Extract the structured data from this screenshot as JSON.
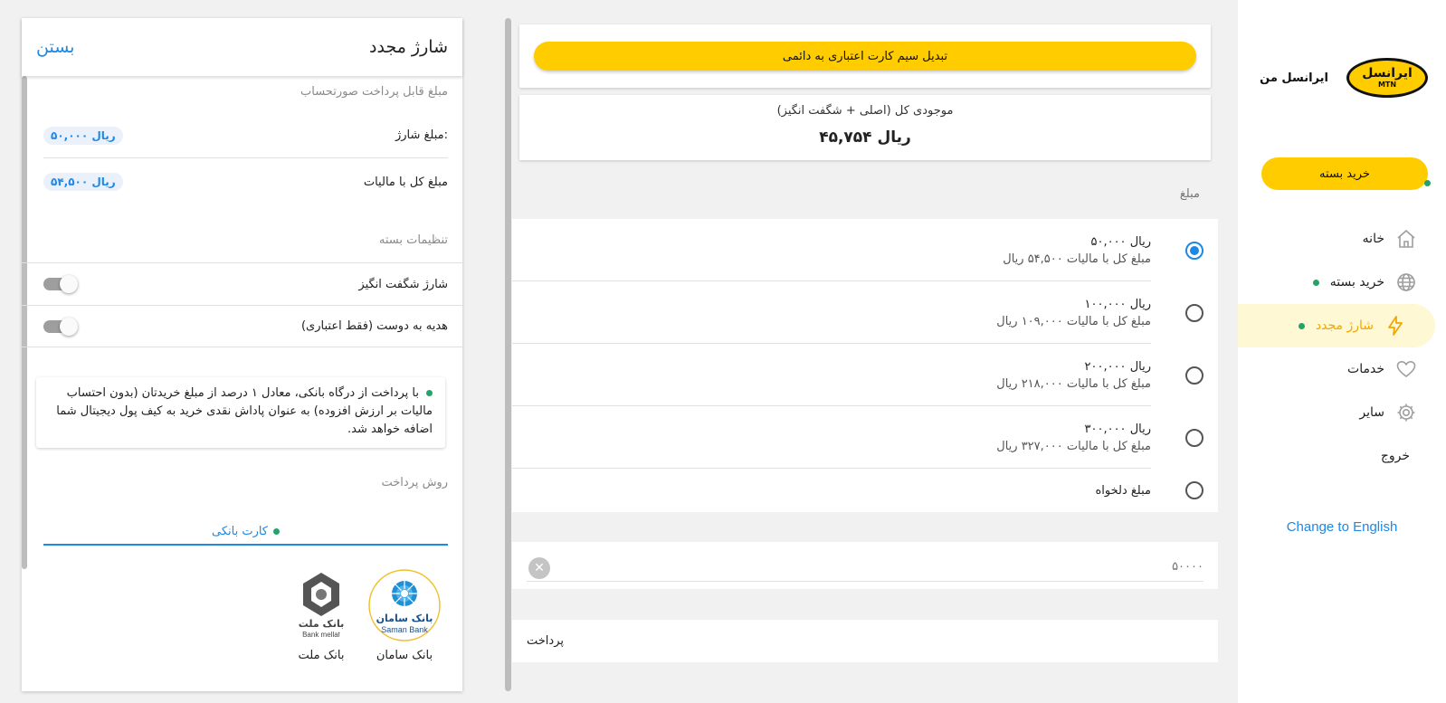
{
  "sidebar": {
    "logo_text": "ایرانسل",
    "logo_sub": "MTN",
    "app_name": "ایرانسل من",
    "buy_pack_button": "خرید بسته",
    "nav": [
      {
        "label": "خانه",
        "icon": "home-icon"
      },
      {
        "label": "خرید بسته",
        "icon": "globe-icon"
      },
      {
        "label": "شارژ مجدد",
        "icon": "lightning-icon"
      },
      {
        "label": "خدمات",
        "icon": "heart-icon"
      },
      {
        "label": "سایر",
        "icon": "gear-icon"
      }
    ],
    "exit_label": "خروج",
    "lang_switch": "Change to English",
    "active_color": "#f0a800",
    "brand_color": "#ffcc00"
  },
  "middle": {
    "convert_button": "تبدیل سیم کارت اعتباری به دائمی",
    "balance_label": "موجودی کل (اصلی + شگفت انگیز)",
    "balance_value": "۴۵,۷۵۴ ریال",
    "amount_heading": "مبلغ",
    "amounts": [
      {
        "amount": "۵۰,۰۰۰ ریال",
        "with_tax": "مبلغ کل با مالیات ۵۴,۵۰۰ ریال",
        "selected": true
      },
      {
        "amount": "۱۰۰,۰۰۰ ریال",
        "with_tax": "مبلغ کل با مالیات ۱۰۹,۰۰۰ ریال",
        "selected": false
      },
      {
        "amount": "۲۰۰,۰۰۰ ریال",
        "with_tax": "مبلغ کل با مالیات ۲۱۸,۰۰۰ ریال",
        "selected": false
      },
      {
        "amount": "۳۰۰,۰۰۰ ریال",
        "with_tax": "مبلغ کل با مالیات ۳۲۷,۰۰۰ ریال",
        "selected": false
      }
    ],
    "custom_amount_label": "مبلغ دلخواه",
    "custom_input_value": "۵۰۰۰۰",
    "pay_label": "پرداخت"
  },
  "left": {
    "title": "شارژ مجدد",
    "close_label": "بستن",
    "invoice_heading": "مبلغ قابل پرداخت صورتحساب",
    "charge_amount_label": "مبلغ شارژ:",
    "charge_amount_value": "۵۰,۰۰۰ ریال",
    "total_with_tax_label": "مبلغ کل با مالیات",
    "total_with_tax_value": "۵۴,۵۰۰ ریال",
    "package_settings_heading": "تنظیمات بسته",
    "toggles": [
      {
        "label": "شارژ شگفت انگیز",
        "on": false
      },
      {
        "label": "هدیه به دوست (فقط اعتباری)",
        "on": false
      }
    ],
    "notice": "با پرداخت از درگاه بانکی، معادل ۱ درصد از مبلغ خریدتان (بدون احتساب مالیات بر ارزش افزوده) به عنوان پاداش نقدی خرید به کیف پول دیجیتال شما اضافه خواهد شد.",
    "payment_method_heading": "روش پرداخت",
    "payment_tab": "کارت بانکی",
    "banks": [
      {
        "name": "بانک سامان",
        "logo_text": "بانک سامان",
        "logo_sub": "Saman Bank"
      },
      {
        "name": "بانک ملت",
        "logo_text": "بانک ملت",
        "logo_sub": "Bank mellat"
      }
    ]
  }
}
